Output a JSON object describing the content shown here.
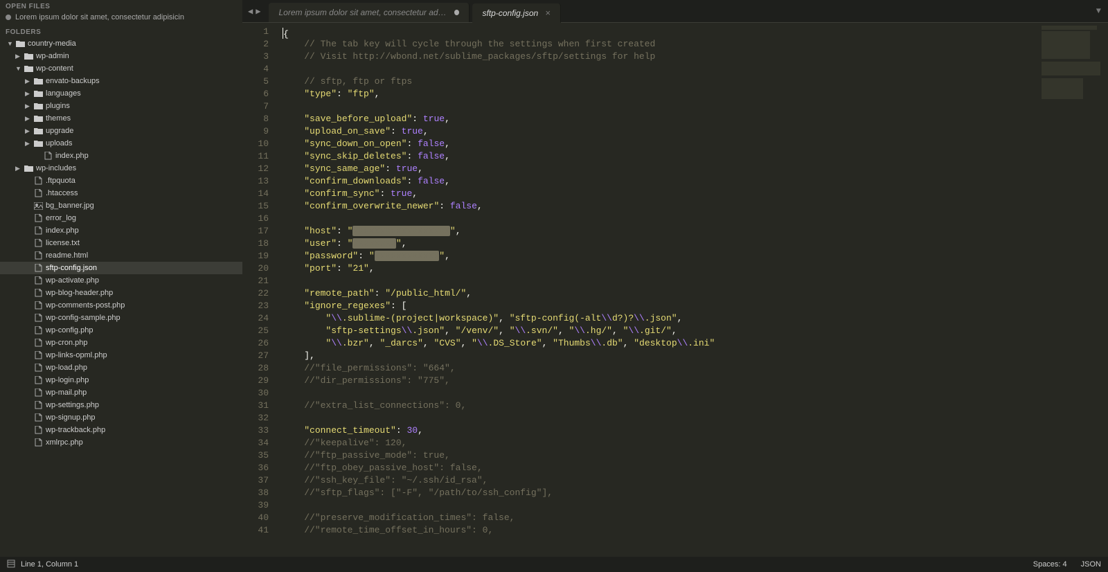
{
  "sidebar": {
    "open_files_header": "OPEN FILES",
    "folders_header": "FOLDERS",
    "open_files": [
      {
        "name": "Lorem ipsum dolor sit amet, consectetur adipisicin"
      }
    ],
    "tree": [
      {
        "type": "folder",
        "name": "country-media",
        "indent": 0,
        "open": true,
        "disclose": "▼"
      },
      {
        "type": "folder",
        "name": "wp-admin",
        "indent": 1,
        "open": false,
        "disclose": "▶"
      },
      {
        "type": "folder",
        "name": "wp-content",
        "indent": 1,
        "open": true,
        "disclose": "▼"
      },
      {
        "type": "folder",
        "name": "envato-backups",
        "indent": 2,
        "open": false,
        "disclose": "▶"
      },
      {
        "type": "folder",
        "name": "languages",
        "indent": 2,
        "open": false,
        "disclose": "▶"
      },
      {
        "type": "folder",
        "name": "plugins",
        "indent": 2,
        "open": false,
        "disclose": "▶"
      },
      {
        "type": "folder",
        "name": "themes",
        "indent": 2,
        "open": false,
        "disclose": "▶"
      },
      {
        "type": "folder",
        "name": "upgrade",
        "indent": 2,
        "open": false,
        "disclose": "▶"
      },
      {
        "type": "folder",
        "name": "uploads",
        "indent": 2,
        "open": false,
        "disclose": "▶"
      },
      {
        "type": "file",
        "name": "index.php",
        "indent": 3
      },
      {
        "type": "folder",
        "name": "wp-includes",
        "indent": 1,
        "open": false,
        "disclose": "▶"
      },
      {
        "type": "file",
        "name": ".ftpquota",
        "indent": 2
      },
      {
        "type": "file",
        "name": ".htaccess",
        "indent": 2
      },
      {
        "type": "image",
        "name": "bg_banner.jpg",
        "indent": 2
      },
      {
        "type": "file",
        "name": "error_log",
        "indent": 2
      },
      {
        "type": "file",
        "name": "index.php",
        "indent": 2
      },
      {
        "type": "file",
        "name": "license.txt",
        "indent": 2
      },
      {
        "type": "file",
        "name": "readme.html",
        "indent": 2
      },
      {
        "type": "file",
        "name": "sftp-config.json",
        "indent": 2,
        "selected": true
      },
      {
        "type": "file",
        "name": "wp-activate.php",
        "indent": 2
      },
      {
        "type": "file",
        "name": "wp-blog-header.php",
        "indent": 2
      },
      {
        "type": "file",
        "name": "wp-comments-post.php",
        "indent": 2
      },
      {
        "type": "file",
        "name": "wp-config-sample.php",
        "indent": 2
      },
      {
        "type": "file",
        "name": "wp-config.php",
        "indent": 2
      },
      {
        "type": "file",
        "name": "wp-cron.php",
        "indent": 2
      },
      {
        "type": "file",
        "name": "wp-links-opml.php",
        "indent": 2
      },
      {
        "type": "file",
        "name": "wp-load.php",
        "indent": 2
      },
      {
        "type": "file",
        "name": "wp-login.php",
        "indent": 2
      },
      {
        "type": "file",
        "name": "wp-mail.php",
        "indent": 2
      },
      {
        "type": "file",
        "name": "wp-settings.php",
        "indent": 2
      },
      {
        "type": "file",
        "name": "wp-signup.php",
        "indent": 2
      },
      {
        "type": "file",
        "name": "wp-trackback.php",
        "indent": 2
      },
      {
        "type": "file",
        "name": "xmlrpc.php",
        "indent": 2
      }
    ]
  },
  "tabs": [
    {
      "label": "Lorem ipsum dolor sit amet, consectetur adipisicin",
      "dirty": true,
      "active": false
    },
    {
      "label": "sftp-config.json",
      "dirty": false,
      "active": true
    }
  ],
  "code": {
    "lines": [
      [
        {
          "t": "punct",
          "v": "{"
        }
      ],
      [
        {
          "t": "cm",
          "v": "    // The tab key will cycle through the settings when first created"
        }
      ],
      [
        {
          "t": "cm",
          "v": "    // Visit http://wbond.net/sublime_packages/sftp/settings for help"
        }
      ],
      [],
      [
        {
          "t": "cm",
          "v": "    // sftp, ftp or ftps"
        }
      ],
      [
        {
          "t": "punct",
          "v": "    "
        },
        {
          "t": "key",
          "v": "\"type\""
        },
        {
          "t": "punct",
          "v": ": "
        },
        {
          "t": "str",
          "v": "\"ftp\""
        },
        {
          "t": "punct",
          "v": ","
        }
      ],
      [],
      [
        {
          "t": "punct",
          "v": "    "
        },
        {
          "t": "key",
          "v": "\"save_before_upload\""
        },
        {
          "t": "punct",
          "v": ": "
        },
        {
          "t": "bool",
          "v": "true"
        },
        {
          "t": "punct",
          "v": ","
        }
      ],
      [
        {
          "t": "punct",
          "v": "    "
        },
        {
          "t": "key",
          "v": "\"upload_on_save\""
        },
        {
          "t": "punct",
          "v": ": "
        },
        {
          "t": "bool",
          "v": "true"
        },
        {
          "t": "punct",
          "v": ","
        }
      ],
      [
        {
          "t": "punct",
          "v": "    "
        },
        {
          "t": "key",
          "v": "\"sync_down_on_open\""
        },
        {
          "t": "punct",
          "v": ": "
        },
        {
          "t": "bool",
          "v": "false"
        },
        {
          "t": "punct",
          "v": ","
        }
      ],
      [
        {
          "t": "punct",
          "v": "    "
        },
        {
          "t": "key",
          "v": "\"sync_skip_deletes\""
        },
        {
          "t": "punct",
          "v": ": "
        },
        {
          "t": "bool",
          "v": "false"
        },
        {
          "t": "punct",
          "v": ","
        }
      ],
      [
        {
          "t": "punct",
          "v": "    "
        },
        {
          "t": "key",
          "v": "\"sync_same_age\""
        },
        {
          "t": "punct",
          "v": ": "
        },
        {
          "t": "bool",
          "v": "true"
        },
        {
          "t": "punct",
          "v": ","
        }
      ],
      [
        {
          "t": "punct",
          "v": "    "
        },
        {
          "t": "key",
          "v": "\"confirm_downloads\""
        },
        {
          "t": "punct",
          "v": ": "
        },
        {
          "t": "bool",
          "v": "false"
        },
        {
          "t": "punct",
          "v": ","
        }
      ],
      [
        {
          "t": "punct",
          "v": "    "
        },
        {
          "t": "key",
          "v": "\"confirm_sync\""
        },
        {
          "t": "punct",
          "v": ": "
        },
        {
          "t": "bool",
          "v": "true"
        },
        {
          "t": "punct",
          "v": ","
        }
      ],
      [
        {
          "t": "punct",
          "v": "    "
        },
        {
          "t": "key",
          "v": "\"confirm_overwrite_newer\""
        },
        {
          "t": "punct",
          "v": ": "
        },
        {
          "t": "bool",
          "v": "false"
        },
        {
          "t": "punct",
          "v": ","
        }
      ],
      [],
      [
        {
          "t": "punct",
          "v": "    "
        },
        {
          "t": "key",
          "v": "\"host\""
        },
        {
          "t": "punct",
          "v": ": "
        },
        {
          "t": "str",
          "v": "\""
        },
        {
          "t": "redact",
          "v": "xxxxxxxxxxxxxxxxxx"
        },
        {
          "t": "str",
          "v": "\""
        },
        {
          "t": "punct",
          "v": ","
        }
      ],
      [
        {
          "t": "punct",
          "v": "    "
        },
        {
          "t": "key",
          "v": "\"user\""
        },
        {
          "t": "punct",
          "v": ": "
        },
        {
          "t": "str",
          "v": "\""
        },
        {
          "t": "redact",
          "v": "xxxxxxxx"
        },
        {
          "t": "str",
          "v": "\""
        },
        {
          "t": "punct",
          "v": ","
        }
      ],
      [
        {
          "t": "punct",
          "v": "    "
        },
        {
          "t": "key",
          "v": "\"password\""
        },
        {
          "t": "punct",
          "v": ": "
        },
        {
          "t": "str",
          "v": "\""
        },
        {
          "t": "redact",
          "v": "xxxxxxxxxxxx"
        },
        {
          "t": "str",
          "v": "\""
        },
        {
          "t": "punct",
          "v": ","
        }
      ],
      [
        {
          "t": "punct",
          "v": "    "
        },
        {
          "t": "key",
          "v": "\"port\""
        },
        {
          "t": "punct",
          "v": ": "
        },
        {
          "t": "str",
          "v": "\"21\""
        },
        {
          "t": "punct",
          "v": ","
        }
      ],
      [],
      [
        {
          "t": "punct",
          "v": "    "
        },
        {
          "t": "key",
          "v": "\"remote_path\""
        },
        {
          "t": "punct",
          "v": ": "
        },
        {
          "t": "str",
          "v": "\"/public_html/\""
        },
        {
          "t": "punct",
          "v": ","
        }
      ],
      [
        {
          "t": "punct",
          "v": "    "
        },
        {
          "t": "key",
          "v": "\"ignore_regexes\""
        },
        {
          "t": "punct",
          "v": ": ["
        }
      ],
      [
        {
          "t": "punct",
          "v": "        "
        },
        {
          "t": "str",
          "v": "\""
        },
        {
          "t": "esc",
          "v": "\\\\"
        },
        {
          "t": "str",
          "v": ".sublime-(project|workspace)\""
        },
        {
          "t": "punct",
          "v": ", "
        },
        {
          "t": "str",
          "v": "\"sftp-config(-alt"
        },
        {
          "t": "esc",
          "v": "\\\\"
        },
        {
          "t": "str",
          "v": "d?)?"
        },
        {
          "t": "esc",
          "v": "\\\\"
        },
        {
          "t": "str",
          "v": ".json\""
        },
        {
          "t": "punct",
          "v": ","
        }
      ],
      [
        {
          "t": "punct",
          "v": "        "
        },
        {
          "t": "str",
          "v": "\"sftp-settings"
        },
        {
          "t": "esc",
          "v": "\\\\"
        },
        {
          "t": "str",
          "v": ".json\""
        },
        {
          "t": "punct",
          "v": ", "
        },
        {
          "t": "str",
          "v": "\"/venv/\""
        },
        {
          "t": "punct",
          "v": ", "
        },
        {
          "t": "str",
          "v": "\""
        },
        {
          "t": "esc",
          "v": "\\\\"
        },
        {
          "t": "str",
          "v": ".svn/\""
        },
        {
          "t": "punct",
          "v": ", "
        },
        {
          "t": "str",
          "v": "\""
        },
        {
          "t": "esc",
          "v": "\\\\"
        },
        {
          "t": "str",
          "v": ".hg/\""
        },
        {
          "t": "punct",
          "v": ", "
        },
        {
          "t": "str",
          "v": "\""
        },
        {
          "t": "esc",
          "v": "\\\\"
        },
        {
          "t": "str",
          "v": ".git/\""
        },
        {
          "t": "punct",
          "v": ","
        }
      ],
      [
        {
          "t": "punct",
          "v": "        "
        },
        {
          "t": "str",
          "v": "\""
        },
        {
          "t": "esc",
          "v": "\\\\"
        },
        {
          "t": "str",
          "v": ".bzr\""
        },
        {
          "t": "punct",
          "v": ", "
        },
        {
          "t": "str",
          "v": "\"_darcs\""
        },
        {
          "t": "punct",
          "v": ", "
        },
        {
          "t": "str",
          "v": "\"CVS\""
        },
        {
          "t": "punct",
          "v": ", "
        },
        {
          "t": "str",
          "v": "\""
        },
        {
          "t": "esc",
          "v": "\\\\"
        },
        {
          "t": "str",
          "v": ".DS_Store\""
        },
        {
          "t": "punct",
          "v": ", "
        },
        {
          "t": "str",
          "v": "\"Thumbs"
        },
        {
          "t": "esc",
          "v": "\\\\"
        },
        {
          "t": "str",
          "v": ".db\""
        },
        {
          "t": "punct",
          "v": ", "
        },
        {
          "t": "str",
          "v": "\"desktop"
        },
        {
          "t": "esc",
          "v": "\\\\"
        },
        {
          "t": "str",
          "v": ".ini\""
        }
      ],
      [
        {
          "t": "punct",
          "v": "    ],"
        }
      ],
      [
        {
          "t": "cm",
          "v": "    //\"file_permissions\": \"664\","
        }
      ],
      [
        {
          "t": "cm",
          "v": "    //\"dir_permissions\": \"775\","
        }
      ],
      [],
      [
        {
          "t": "cm",
          "v": "    //\"extra_list_connections\": 0,"
        }
      ],
      [],
      [
        {
          "t": "punct",
          "v": "    "
        },
        {
          "t": "key",
          "v": "\"connect_timeout\""
        },
        {
          "t": "punct",
          "v": ": "
        },
        {
          "t": "num",
          "v": "30"
        },
        {
          "t": "punct",
          "v": ","
        }
      ],
      [
        {
          "t": "cm",
          "v": "    //\"keepalive\": 120,"
        }
      ],
      [
        {
          "t": "cm",
          "v": "    //\"ftp_passive_mode\": true,"
        }
      ],
      [
        {
          "t": "cm",
          "v": "    //\"ftp_obey_passive_host\": false,"
        }
      ],
      [
        {
          "t": "cm",
          "v": "    //\"ssh_key_file\": \"~/.ssh/id_rsa\","
        }
      ],
      [
        {
          "t": "cm",
          "v": "    //\"sftp_flags\": [\"-F\", \"/path/to/ssh_config\"],"
        }
      ],
      [],
      [
        {
          "t": "cm",
          "v": "    //\"preserve_modification_times\": false,"
        }
      ],
      [
        {
          "t": "cm",
          "v": "    //\"remote_time_offset_in_hours\": 0,"
        }
      ]
    ]
  },
  "statusbar": {
    "position": "Line 1, Column 1",
    "spaces": "Spaces: 4",
    "syntax": "JSON"
  }
}
